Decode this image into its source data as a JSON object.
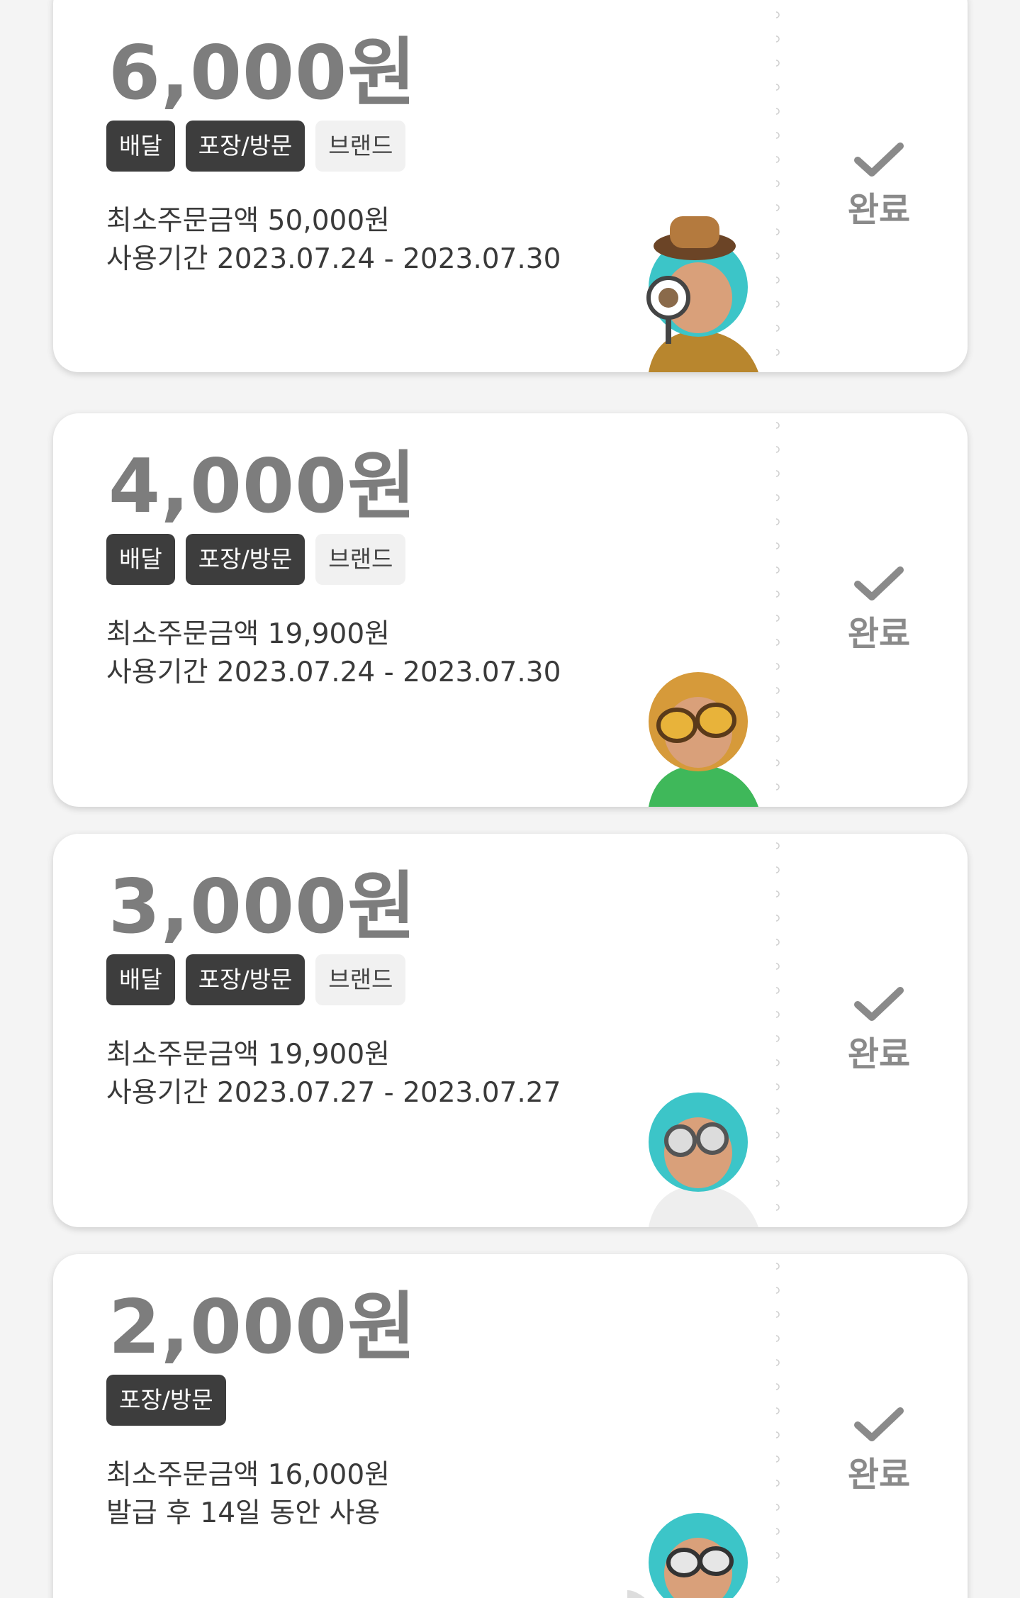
{
  "coupons": [
    {
      "amount": "6,000원",
      "tags": [
        {
          "label": "배달",
          "style": "dark"
        },
        {
          "label": "포장/방문",
          "style": "dark"
        },
        {
          "label": "브랜드",
          "style": "light"
        }
      ],
      "min_order": "최소주문금액 50,000원",
      "period": "사용기간 2023.07.24 - 2023.07.30",
      "status": "완료",
      "illustration": "detective-character-magnifier"
    },
    {
      "amount": "4,000원",
      "tags": [
        {
          "label": "배달",
          "style": "dark"
        },
        {
          "label": "포장/방문",
          "style": "dark"
        },
        {
          "label": "브랜드",
          "style": "light"
        }
      ],
      "min_order": "최소주문금액 19,900원",
      "period": "사용기간 2023.07.24 - 2023.07.30",
      "status": "완료",
      "illustration": "goggles-character-green-shirt"
    },
    {
      "amount": "3,000원",
      "tags": [
        {
          "label": "배달",
          "style": "dark"
        },
        {
          "label": "포장/방문",
          "style": "dark"
        },
        {
          "label": "브랜드",
          "style": "light"
        }
      ],
      "min_order": "최소주문금액 19,900원",
      "period": "사용기간 2023.07.27 - 2023.07.27",
      "status": "완료",
      "illustration": "glasses-character-white-coat"
    },
    {
      "amount": "2,000원",
      "tags": [
        {
          "label": "포장/방문",
          "style": "dark"
        }
      ],
      "min_order": "최소주문금액 16,000원",
      "period": "발급 후 14일 동안 사용",
      "status": "완료",
      "illustration": "goggles-character-pointing"
    }
  ],
  "colors": {
    "amount": "#7d7d7d",
    "tag_dark_bg": "#3d3d3d",
    "tag_light_bg": "#f1f1f1",
    "status": "#8a8a8a"
  },
  "icons": {
    "status": "check-icon"
  }
}
